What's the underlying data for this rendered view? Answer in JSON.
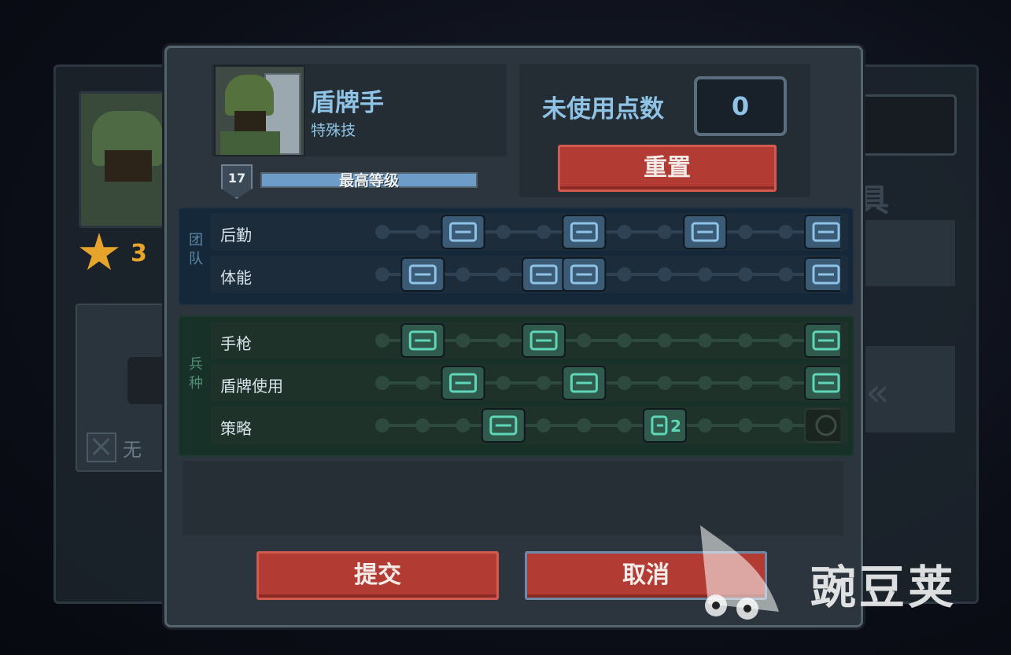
{
  "background": {
    "stars": "3",
    "none_label": "无",
    "right_glyph": "具"
  },
  "dialog": {
    "class_name": "盾牌手",
    "class_sub": "特殊技",
    "level": "17",
    "xp_label": "最高等级",
    "xp_fraction": 1.0,
    "points_label": "未使用点数",
    "points_value": "0",
    "reset_label": "重置",
    "submit_label": "提交",
    "cancel_label": "取消"
  },
  "groups": [
    {
      "label": "团队",
      "rows": [
        {
          "label": "后勤",
          "nodes": [
            "dot",
            "dot",
            "skill",
            "dot",
            "dot",
            "skill",
            "dot",
            "dot",
            "skill",
            "dot",
            "dot",
            "skill"
          ],
          "icons": [
            "supply-icon",
            "shield-plus-icon",
            "medkit-icon",
            "cart-icon"
          ]
        },
        {
          "label": "体能",
          "nodes": [
            "dot",
            "skill",
            "dot",
            "dot",
            "skill",
            "skill",
            "dot",
            "dot",
            "dot",
            "dot",
            "dot",
            "skill"
          ],
          "icons": [
            "knife-icon",
            "wing-icon",
            "grid-icon",
            "face-icon"
          ]
        }
      ]
    },
    {
      "label": "兵种",
      "rows": [
        {
          "label": "手枪",
          "nodes": [
            "dot",
            "skill",
            "dot",
            "dot",
            "skill",
            "dot",
            "dot",
            "dot",
            "dot",
            "dot",
            "dot",
            "skill"
          ],
          "icons": [
            "ammo-icon",
            "crown-icon",
            "burst-icon"
          ]
        },
        {
          "label": "盾牌使用",
          "nodes": [
            "dot",
            "dot",
            "skill",
            "dot",
            "dot",
            "skill",
            "dot",
            "dot",
            "dot",
            "dot",
            "dot",
            "skill"
          ],
          "icons": [
            "badge-icon",
            "chevron-icon",
            "wrench-icon"
          ]
        },
        {
          "label": "策略",
          "nodes": [
            "dot",
            "dot",
            "dot",
            "skill",
            "dot",
            "dot",
            "dot",
            "skill",
            "dot",
            "dot",
            "dot",
            "locked"
          ],
          "icons": [
            "target-icon",
            "camera-icon",
            "locked-icon"
          ],
          "icon_text": [
            "",
            "2",
            ""
          ]
        }
      ]
    }
  ],
  "watermark": "豌豆荚",
  "colors": {
    "accent_blue": "#8fc3e6",
    "button_red": "#b23c34",
    "team_bg": "#14283a",
    "arms_bg": "#173128",
    "team_icon": "#8fc3e6",
    "arms_icon": "#5fd6b8"
  }
}
